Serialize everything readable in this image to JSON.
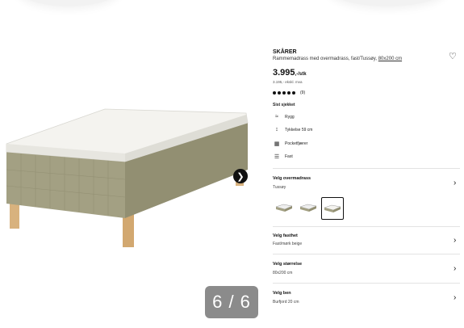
{
  "product": {
    "name": "SKÅRER",
    "description": "Rammemadrass med overmadrass, fast/Tussøy,",
    "size_link": "80x200 cm",
    "price": "3.995",
    "price_unit": ",-/stk",
    "price_excl": "3.195,- ekskl. mva",
    "rating_count": "(9)",
    "stars": 5
  },
  "gallery": {
    "counter": "6 / 6"
  },
  "features": {
    "label": "Sist sjekket",
    "items": [
      {
        "icon": "back-support-icon",
        "label": "Rygg"
      },
      {
        "icon": "thickness-icon",
        "label": "Tykkelse 59 cm"
      },
      {
        "icon": "pocket-spring-icon",
        "label": "Pocketfjærer"
      },
      {
        "icon": "firmness-icon",
        "label": "Fast"
      }
    ]
  },
  "selectors": [
    {
      "label": "Velg overmadrass",
      "value": "Tussøy"
    },
    {
      "label": "Velg fasthet",
      "value": "Fast/mørk beige"
    },
    {
      "label": "Velg størrelse",
      "value": "80x200 cm"
    },
    {
      "label": "Velg ben",
      "value": "Burfjord 20 cm"
    }
  ],
  "colors": {
    "fabric": "#9c9a7c",
    "legs": "#d8b27e",
    "topper": "#f4f3ef"
  }
}
